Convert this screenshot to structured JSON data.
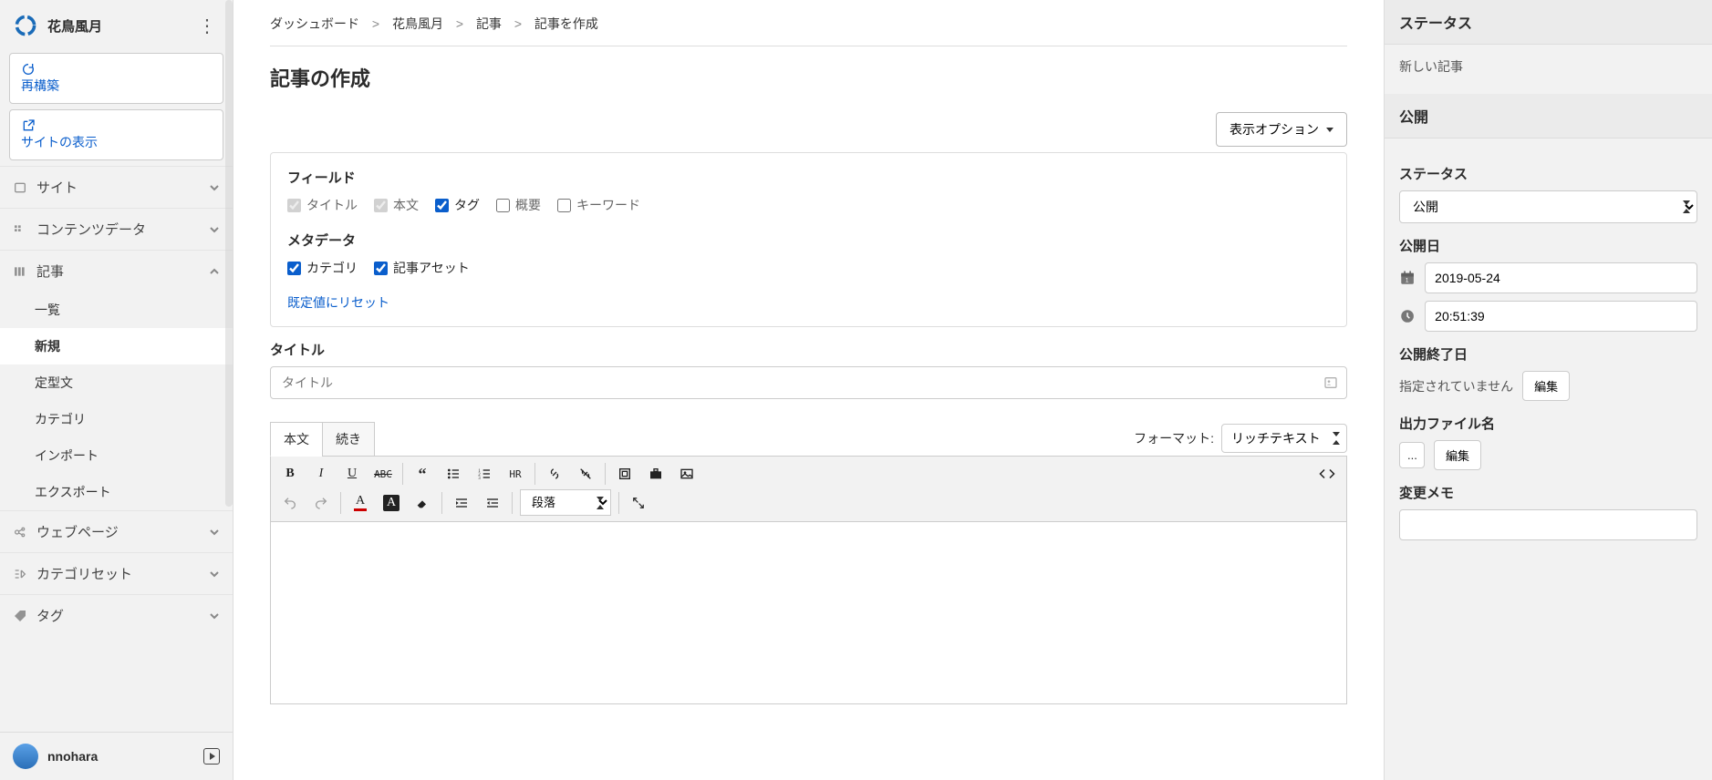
{
  "site": {
    "title": "花鳥風月"
  },
  "sidebar": {
    "rebuild": "再構築",
    "view_site": "サイトの表示",
    "groups": {
      "site": "サイト",
      "content_data": "コンテンツデータ",
      "entries": "記事",
      "webpages": "ウェブページ",
      "category_set": "カテゴリセット",
      "tags": "タグ"
    },
    "entries_sub": {
      "list": "一覧",
      "new": "新規",
      "templates": "定型文",
      "categories": "カテゴリ",
      "import": "インポート",
      "export": "エクスポート"
    }
  },
  "user": {
    "name": "nnohara"
  },
  "breadcrumb": {
    "dashboard": "ダッシュボード",
    "site": "花鳥風月",
    "entries": "記事",
    "create": "記事を作成"
  },
  "page": {
    "title": "記事の作成",
    "display_options": "表示オプション"
  },
  "fields_panel": {
    "fields_heading": "フィールド",
    "title": "タイトル",
    "body": "本文",
    "tags": "タグ",
    "summary": "概要",
    "keywords": "キーワード",
    "metadata_heading": "メタデータ",
    "category": "カテゴリ",
    "entry_asset": "記事アセット",
    "reset": "既定値にリセット"
  },
  "title_field": {
    "label": "タイトル",
    "placeholder": "タイトル"
  },
  "editor": {
    "tab_body": "本文",
    "tab_more": "続き",
    "format_label": "フォーマット:",
    "format_value": "リッチテキスト",
    "block_format": "段落",
    "hr": "HR",
    "abc": "ABC"
  },
  "rail": {
    "status_heading": "ステータス",
    "status_text": "新しい記事",
    "publish_heading": "公開",
    "status_label": "ステータス",
    "status_value": "公開",
    "pubdate_label": "公開日",
    "pubdate": "2019-05-24",
    "pubtime": "20:51:39",
    "unpub_label": "公開終了日",
    "unpub_text": "指定されていません",
    "edit": "編集",
    "outfile_label": "出力ファイル名",
    "outfile_ellipsis": "...",
    "memo_label": "変更メモ"
  }
}
